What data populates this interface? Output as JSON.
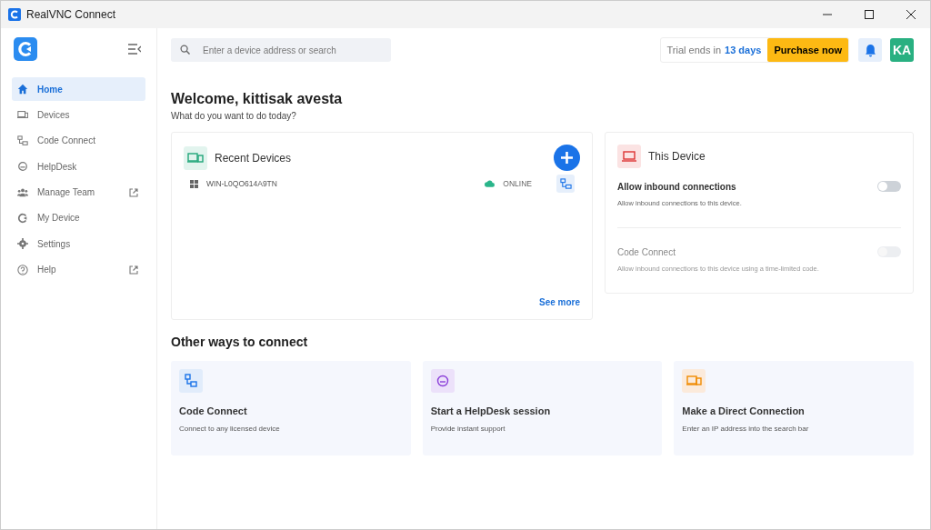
{
  "window": {
    "title": "RealVNC Connect"
  },
  "sidebar": {
    "items": [
      {
        "label": "Home",
        "kind": "home",
        "selected": true,
        "external": false
      },
      {
        "label": "Devices",
        "kind": "devices",
        "selected": false,
        "external": false
      },
      {
        "label": "Code Connect",
        "kind": "code",
        "selected": false,
        "external": false
      },
      {
        "label": "HelpDesk",
        "kind": "helpdesk",
        "selected": false,
        "external": false
      },
      {
        "label": "Manage Team",
        "kind": "team",
        "selected": false,
        "external": true
      },
      {
        "label": "My Device",
        "kind": "mydevice",
        "selected": false,
        "external": false
      },
      {
        "label": "Settings",
        "kind": "settings",
        "selected": false,
        "external": false
      },
      {
        "label": "Help",
        "kind": "help",
        "selected": false,
        "external": true
      }
    ]
  },
  "search": {
    "placeholder": "Enter a device address or search"
  },
  "trial": {
    "text": "Trial ends in",
    "days": "13 days",
    "button": "Purchase now"
  },
  "avatar": "KA",
  "welcome": {
    "title": "Welcome, kittisak avesta",
    "subtitle": "What do you want to do today?"
  },
  "recent": {
    "title": "Recent Devices",
    "devices": [
      {
        "name": "WIN-L0QO614A9TN",
        "status": "ONLINE"
      }
    ],
    "more": "See more"
  },
  "this_device": {
    "title": "This Device",
    "settings": [
      {
        "label": "Allow inbound connections",
        "description": "Allow inbound connections to this device.",
        "on": false,
        "disabled": false
      },
      {
        "label": "Code Connect",
        "description": "Allow inbound connections to this device using a time-limited code.",
        "on": false,
        "disabled": true
      }
    ]
  },
  "other": {
    "title": "Other ways to connect",
    "cards": [
      {
        "kind": "code",
        "title": "Code Connect",
        "description": "Connect to any licensed device"
      },
      {
        "kind": "helpdesk",
        "title": "Start a HelpDesk session",
        "description": "Provide instant support"
      },
      {
        "kind": "direct",
        "title": "Make a Direct Connection",
        "description": "Enter an IP address into the search bar"
      }
    ]
  }
}
